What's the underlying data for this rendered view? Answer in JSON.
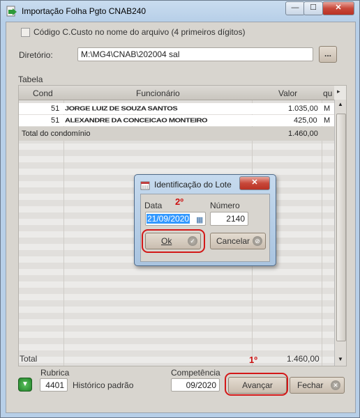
{
  "window": {
    "title": "Importação Folha Pgto CNAB240",
    "min_glyph": "—",
    "max_glyph": "☐",
    "close_glyph": "✕"
  },
  "options": {
    "cost_center_label": "Código C.Custo no nome do arquivo (4 primeiros dígitos)",
    "cost_center_checked": false
  },
  "directory": {
    "label": "Diretório:",
    "value": "M:\\MG4\\CNAB\\202004 sal",
    "browse_label": "..."
  },
  "table": {
    "caption": "Tabela",
    "columns": [
      "Cond",
      "Funcionário",
      "Valor",
      "qui"
    ],
    "rows": [
      {
        "cond": "51",
        "funcionario": "JORGE LUIZ DE SOUZA SANTOS",
        "valor": "1.035,00",
        "flag": "M"
      },
      {
        "cond": "51",
        "funcionario": "ALEXANDRE DA CONCEICAO MONTEIRO",
        "valor": "425,00",
        "flag": "M"
      }
    ],
    "subtotal_label": "Total do condomínio",
    "subtotal_value": "1.460,00",
    "total_label": "Total",
    "total_value": "1.460,00"
  },
  "footer": {
    "rubrica_label": "Rubrica",
    "rubrica_value": "4401",
    "rubrica_desc": "Histórico padrão",
    "competencia_label": "Competência",
    "competencia_value": "09/2020",
    "advance_label": "Avançar",
    "close_label": "Fechar"
  },
  "dialog": {
    "title": "Identificação do Lote",
    "date_label": "Data",
    "date_value": "21/09/2020",
    "number_label": "Número",
    "number_value": "2140",
    "ok_label": "Ok",
    "cancel_label": "Cancelar"
  },
  "annotations": {
    "step1": "1º",
    "step2": "2º"
  },
  "colors": {
    "annotation_red": "#d31818",
    "selection_blue": "#3399ff",
    "accent_green": "#2e9a3a"
  }
}
